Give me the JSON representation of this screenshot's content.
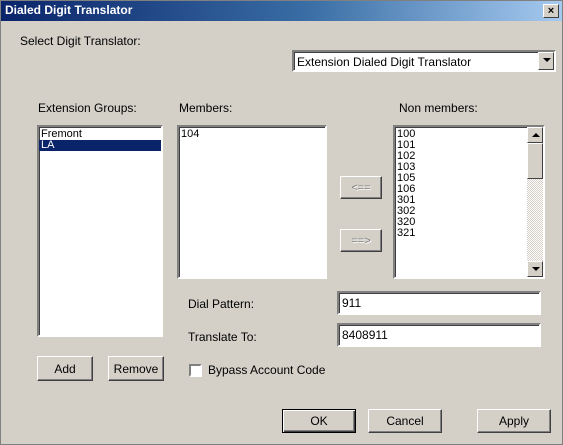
{
  "window": {
    "title": "Dialed Digit Translator",
    "close_glyph": "×"
  },
  "selector": {
    "label": "Select Digit Translator:",
    "value": "Extension Dialed Digit Translator"
  },
  "groups": {
    "label": "Extension Groups:",
    "items": [
      "Fremont",
      "LA"
    ],
    "selected": "LA",
    "add_label": "Add",
    "remove_label": "Remove"
  },
  "members": {
    "label": "Members:",
    "items": [
      "104"
    ]
  },
  "transfer": {
    "add_label": "<==",
    "remove_label": "==>"
  },
  "nonmembers": {
    "label": "Non members:",
    "items": [
      "100",
      "101",
      "102",
      "103",
      "105",
      "106",
      "301",
      "302",
      "320",
      "321"
    ]
  },
  "dial_pattern": {
    "label": "Dial Pattern:",
    "value": "911"
  },
  "translate_to": {
    "label": "Translate To:",
    "value": "8408911"
  },
  "bypass": {
    "label": "Bypass Account Code",
    "checked": false
  },
  "footer": {
    "ok_label": "OK",
    "cancel_label": "Cancel",
    "apply_label": "Apply"
  }
}
